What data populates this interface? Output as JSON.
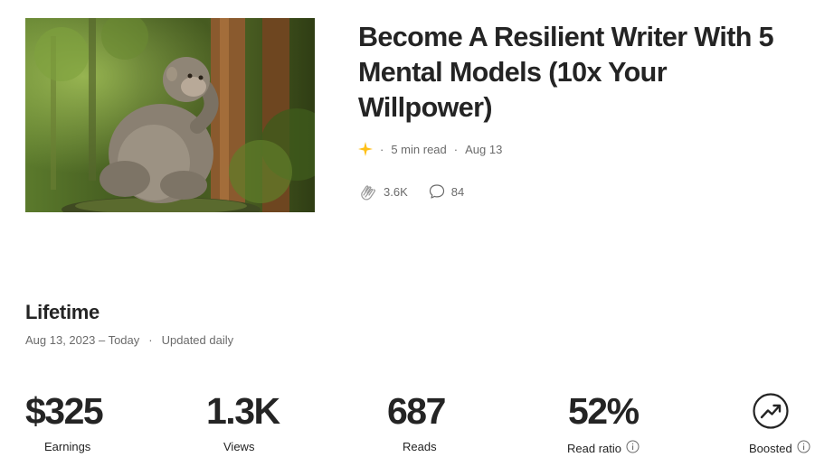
{
  "article": {
    "thumbnail_alt": "Macaque monkey sitting on a mossy rock in a green forest, hand on chin",
    "title": "Become A Resilient Writer With 5 Mental Models (10x Your Willpower)",
    "read_time": "5 min read",
    "date": "Aug 13",
    "claps": "3.6K",
    "responses": "84",
    "icons": {
      "member": "star-sparkle-icon",
      "claps": "clap-icon",
      "responses": "speech-bubble-icon"
    },
    "accent_color": "#FFC017"
  },
  "lifetime": {
    "heading": "Lifetime",
    "range": "Aug 13, 2023 – Today",
    "note": "Updated daily"
  },
  "metrics": [
    {
      "value": "$325",
      "label": "Earnings"
    },
    {
      "value": "1.3K",
      "label": "Views"
    },
    {
      "value": "687",
      "label": "Reads"
    },
    {
      "value": "52%",
      "label": "Read ratio"
    },
    {
      "label": "Boosted",
      "icon": "trending-up-icon"
    }
  ]
}
